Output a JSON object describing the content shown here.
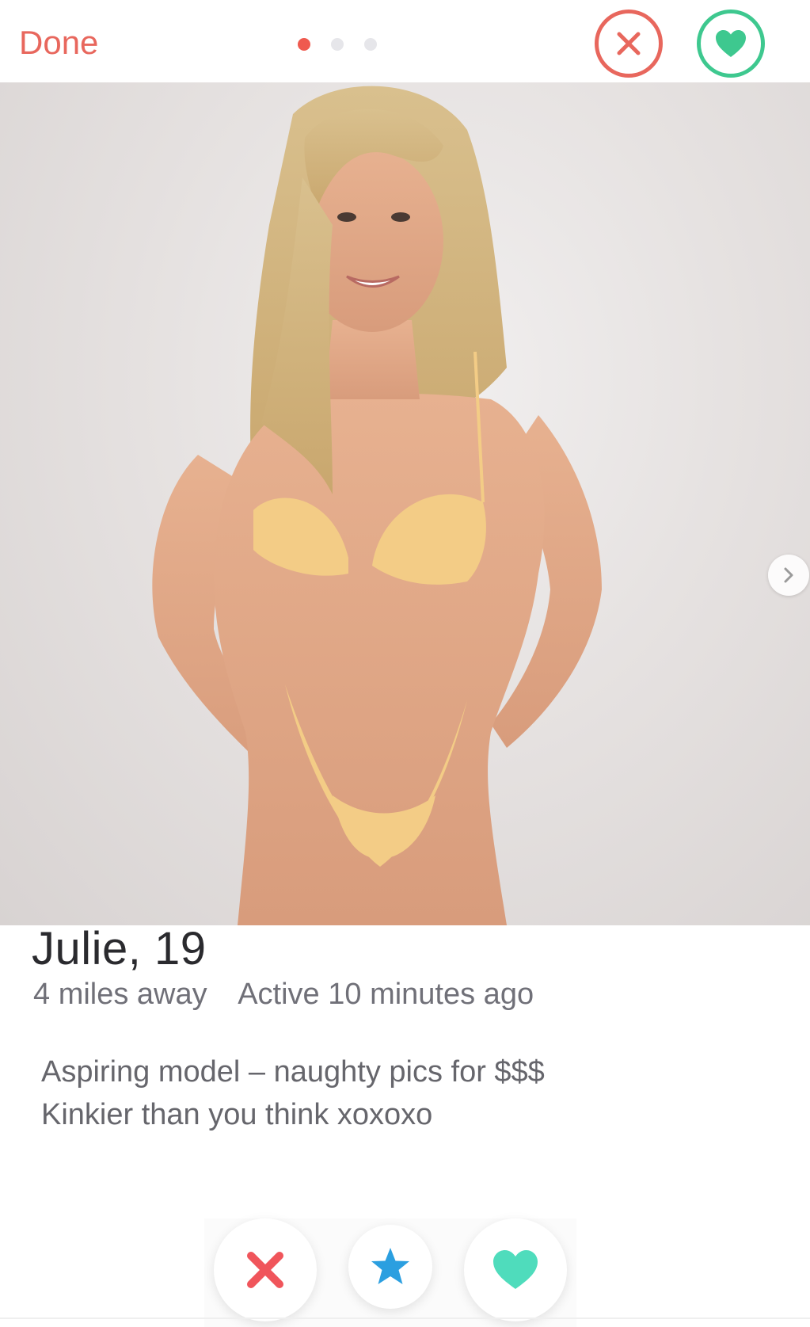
{
  "header": {
    "done_label": "Done",
    "page_dots": {
      "count": 3,
      "active_index": 0
    },
    "nope_icon": "x-circle-icon",
    "like_icon": "heart-circle-icon"
  },
  "photo": {
    "next_icon": "chevron-right-icon"
  },
  "profile": {
    "name_age": "Julie, 19",
    "distance": "4 miles away",
    "activity": "Active 10 minutes ago",
    "bio_line_1": "Aspiring model – naughty pics for $$$",
    "bio_line_2": "Kinkier than you think xoxoxo"
  },
  "actions": {
    "nope_icon": "x-icon",
    "superlike_icon": "star-icon",
    "like_icon": "heart-icon"
  },
  "colors": {
    "accent_red": "#e8675d",
    "accent_green": "#3ec88f",
    "star_blue": "#2b9fe0",
    "heart_teal": "#4fdcbc"
  }
}
